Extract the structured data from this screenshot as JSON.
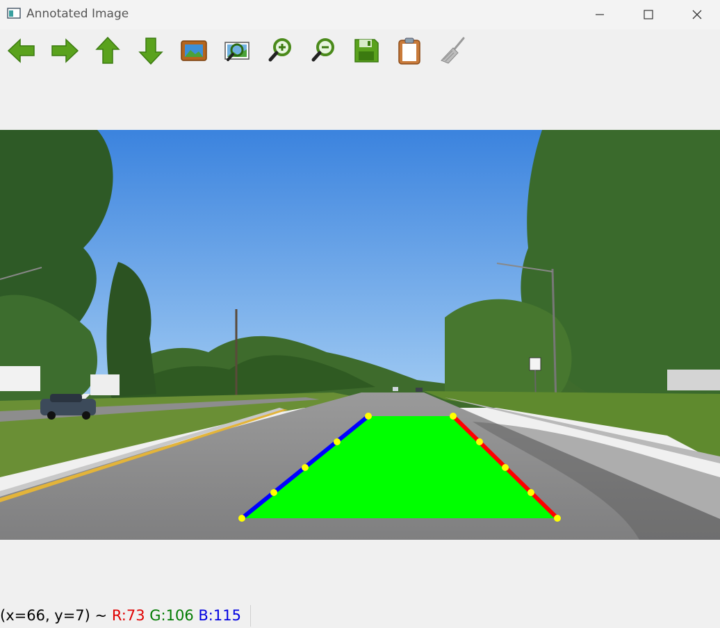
{
  "window": {
    "title": "Annotated Image",
    "controls": [
      "minimize",
      "maximize",
      "close"
    ]
  },
  "toolbar": {
    "buttons": [
      {
        "name": "back",
        "icon": "arrow-left-icon"
      },
      {
        "name": "forward",
        "icon": "arrow-right-icon"
      },
      {
        "name": "up",
        "icon": "arrow-up-icon"
      },
      {
        "name": "down",
        "icon": "arrow-down-icon"
      },
      {
        "name": "fit-to-window",
        "icon": "picture-frame-icon"
      },
      {
        "name": "zoom-area",
        "icon": "zoom-image-icon"
      },
      {
        "name": "zoom-in",
        "icon": "zoom-in-icon"
      },
      {
        "name": "zoom-out",
        "icon": "zoom-out-icon"
      },
      {
        "name": "save",
        "icon": "floppy-disk-icon"
      },
      {
        "name": "copy-to-clipboard",
        "icon": "clipboard-icon"
      },
      {
        "name": "clear",
        "icon": "broom-icon"
      }
    ]
  },
  "annotation": {
    "fill_color": "#00ff00",
    "left_lane_color": "#0000ff",
    "right_lane_color": "#ff0000",
    "vertex_color": "#ffff00"
  },
  "status": {
    "coords": "(x=66, y=7) ~",
    "r": "R:73",
    "g": "G:106",
    "b": "B:115"
  }
}
